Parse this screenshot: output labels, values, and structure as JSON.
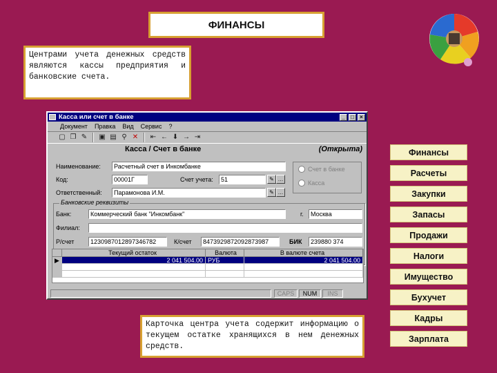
{
  "slide": {
    "title": "ФИНАНСЫ",
    "note_top": "Центрами учета денежных средств являются кассы предприятия и банковские счета.",
    "note_bottom": "Карточка центра учета содержит информацию о текущем остатке хранящихся в нем денежных средств."
  },
  "window": {
    "title": "Касса или счет в банке",
    "menu": [
      "Документ",
      "Правка",
      "Вид",
      "Сервис",
      "?"
    ],
    "heading": "Касса / Счет в банке",
    "status_word": "(Открыта)",
    "fields": {
      "name_label": "Наименование:",
      "name_value": "Расчетный счет в Инкомбанке",
      "code_label": "Код:",
      "code_value": "00001Г",
      "account_label": "Счет учета:",
      "account_value": "51",
      "responsible_label": "Ответственный:",
      "responsible_value": "Парамонова И.М."
    },
    "radios": {
      "option1": "Счет в банке",
      "option2": "Касса"
    },
    "bank_group": {
      "legend": "Банковские реквизиты",
      "bank_label": "Банк:",
      "bank_value": "Коммерческий банк \"Инкомбанк\"",
      "city_label": "г.",
      "city_value": "Москва",
      "branch_label": "Филиал:",
      "branch_value": "",
      "rs_label": "Р/счет",
      "rs_value": "1230987012897346782",
      "ks_label": "К/счет",
      "ks_value": "8473929872092873987",
      "bik_label": "БИК",
      "bik_value": "239880 374"
    },
    "grid": {
      "headers": [
        "Текущий остаток",
        "Валюта",
        "В валюте счета"
      ],
      "rows": [
        {
          "balance": "2 041 504.00",
          "currency": "РУБ",
          "in_account_currency": "2 041 504.00"
        }
      ]
    },
    "statusbar": [
      "CAPS",
      "NUM",
      "INS"
    ]
  },
  "nav": [
    "Финансы",
    "Расчеты",
    "Закупки",
    "Запасы",
    "Продажи",
    "Налоги",
    "Имущество",
    "Бухучет",
    "Кадры",
    "Зарплата"
  ],
  "colors": {
    "background": "#9a1a52",
    "frame": "#d7a032",
    "titlebar": "#000080",
    "nav_fill": "#f7f2c6"
  }
}
